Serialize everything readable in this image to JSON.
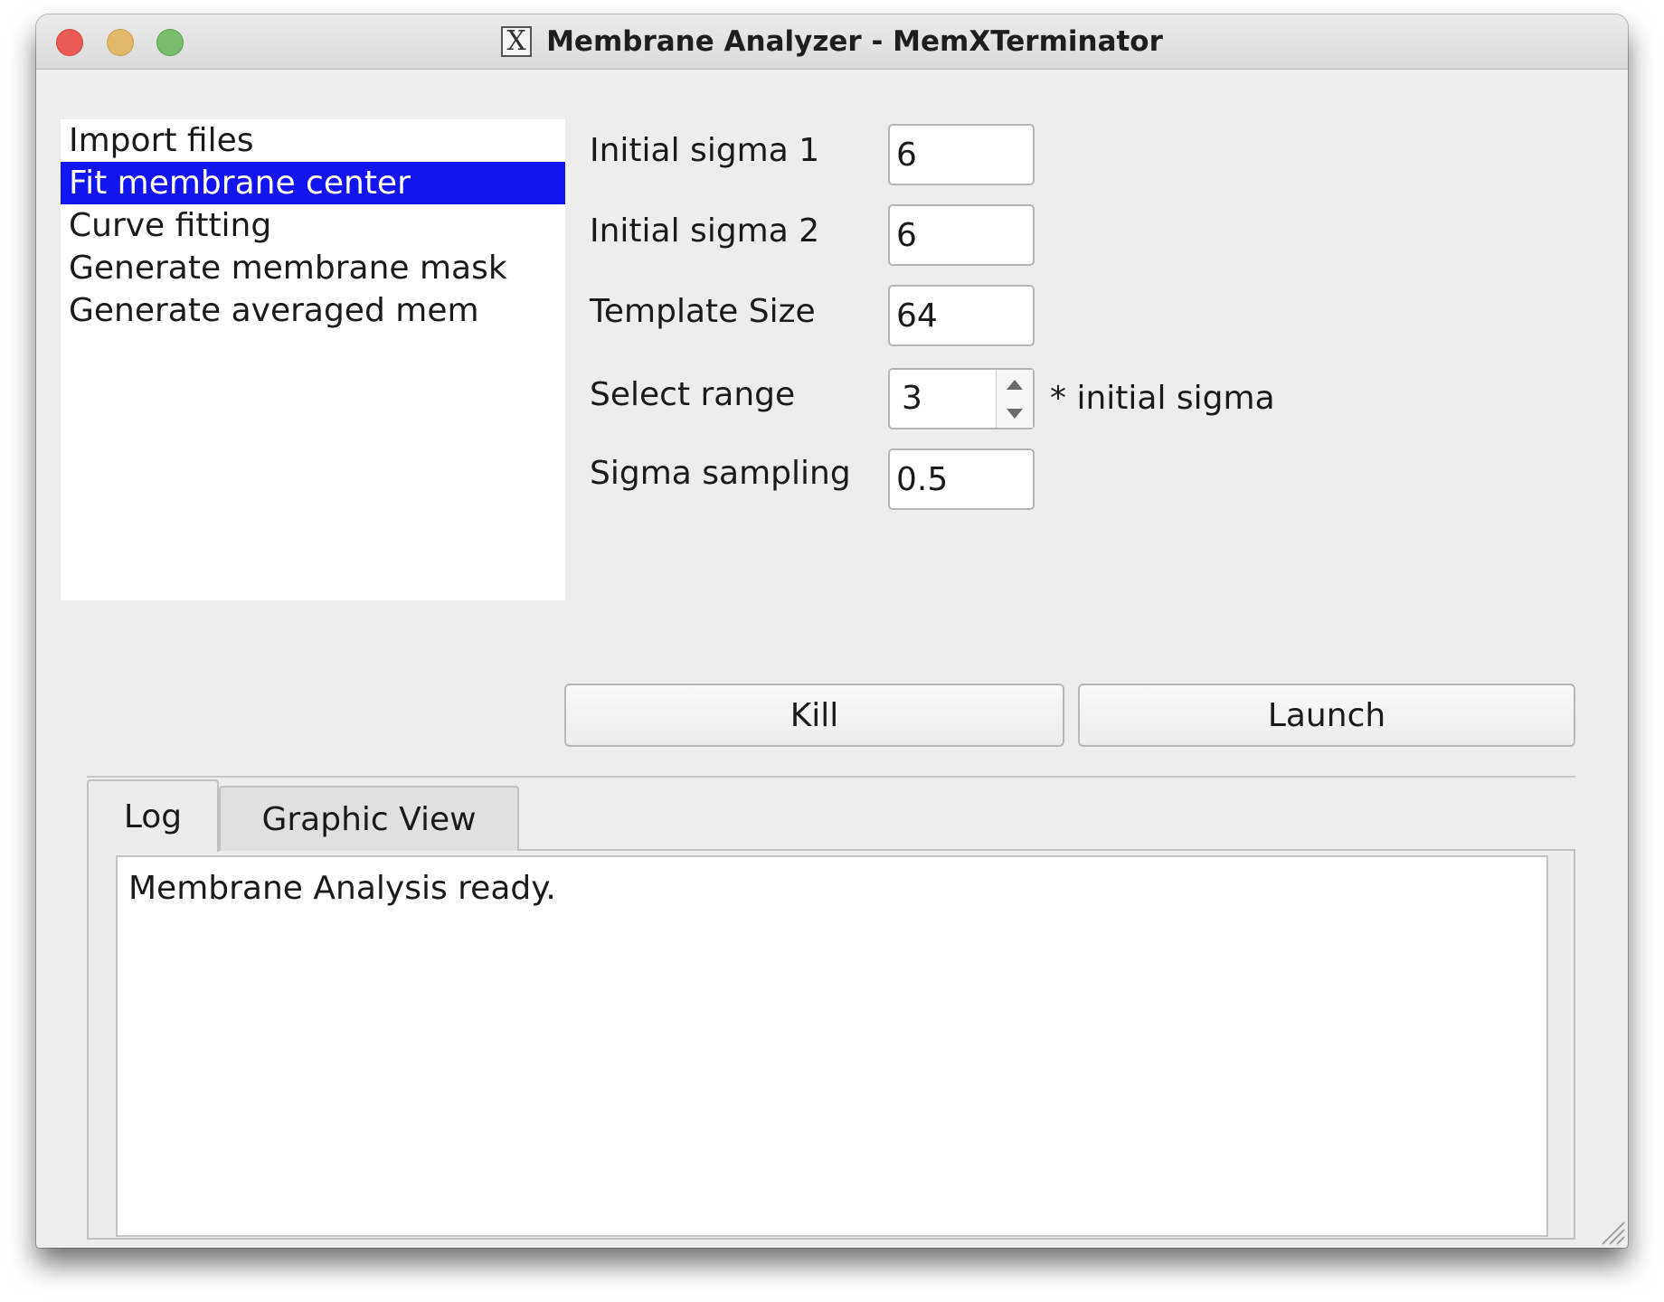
{
  "window": {
    "title": "Membrane Analyzer - MemXTerminator",
    "app_icon": "x-window-icon",
    "controls": [
      "close",
      "minimize",
      "maximize"
    ]
  },
  "task_list": {
    "items": [
      {
        "label": "Import files",
        "selected": false
      },
      {
        "label": "Fit membrane center",
        "selected": true
      },
      {
        "label": "Curve fitting",
        "selected": false
      },
      {
        "label": "Generate membrane mask",
        "selected": false
      },
      {
        "label": "Generate averaged mem",
        "selected": false
      }
    ],
    "selected_color": "#1414ef"
  },
  "form": {
    "initial_sigma_1": {
      "label": "Initial sigma 1",
      "value": "6"
    },
    "initial_sigma_2": {
      "label": "Initial sigma 2",
      "value": "6"
    },
    "template_size": {
      "label": "Template Size",
      "value": "64"
    },
    "select_range": {
      "label": "Select range",
      "value": "3",
      "suffix": "* initial sigma"
    },
    "sigma_sampling": {
      "label": "Sigma sampling",
      "value": "0.5"
    }
  },
  "actions": {
    "kill_label": "Kill",
    "launch_label": "Launch"
  },
  "tabs": [
    {
      "label": "Log",
      "active": true
    },
    {
      "label": "Graphic View",
      "active": false
    }
  ],
  "log": {
    "text": "Membrane Analysis ready."
  }
}
